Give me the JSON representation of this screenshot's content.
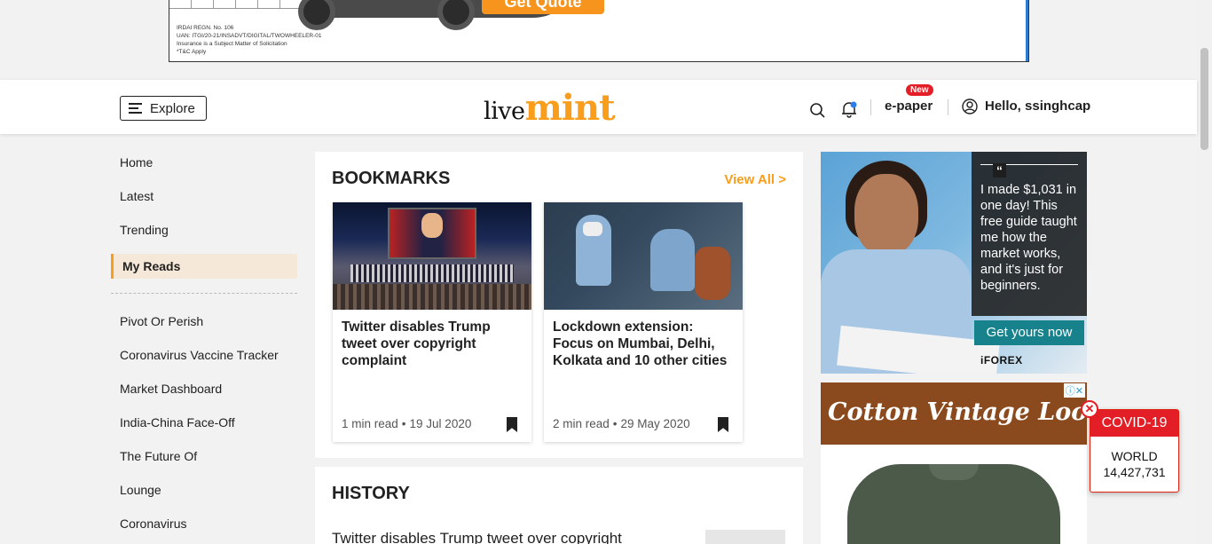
{
  "top_ad": {
    "legal_lines": [
      "IRDAI REGN. No. 106",
      "UAN: ITGI/20-21/INSADVT/DIGITAL/TWOWHEELER-01",
      "Insurance is a Subject Matter of Solicitation",
      "*T&C Apply"
    ],
    "cta_label": "Get Quote"
  },
  "header": {
    "explore_label": "Explore",
    "logo_live": "live",
    "logo_mint": "mint",
    "epaper_label": "e-paper",
    "new_badge": "New",
    "greeting": "Hello, ssinghcap"
  },
  "leftnav": {
    "primary": [
      {
        "label": "Home"
      },
      {
        "label": "Latest"
      },
      {
        "label": "Trending"
      }
    ],
    "active": {
      "label": "My Reads"
    },
    "secondary": [
      {
        "label": "Pivot Or Perish"
      },
      {
        "label": "Coronavirus Vaccine Tracker"
      },
      {
        "label": "Market Dashboard"
      },
      {
        "label": "India-China Face-Off"
      },
      {
        "label": "The Future Of"
      },
      {
        "label": "Lounge"
      },
      {
        "label": "Coronavirus"
      }
    ]
  },
  "bookmarks": {
    "title": "BOOKMARKS",
    "view_all": "View All >",
    "articles": [
      {
        "title": "Twitter disables Trump tweet over copyright complaint",
        "read_time": "1 min read",
        "date": "19 Jul 2020"
      },
      {
        "title": "Lockdown extension: Focus on Mumbai, Delhi, Kolkata and 10 other cities",
        "read_time": "2 min read",
        "date": "29 May 2020"
      }
    ]
  },
  "history": {
    "title": "HISTORY",
    "first_item": "Twitter disables Trump tweet over copyright"
  },
  "right_ads": {
    "ad1": {
      "quote_mark": "“",
      "quote": "I made $1,031 in one day! This free guide taught me how the market works, and it's just for beginners.",
      "cta": "Get yours now",
      "brand": "iFOREX"
    },
    "ad2": {
      "banner": "Cotton Vintage Looks",
      "adchoice": "ⓘ✕"
    }
  },
  "covid_widget": {
    "title": "COVID-19",
    "label": "WORLD",
    "count": "14,427,731",
    "close": "✕"
  },
  "colors": {
    "brand_orange": "#f99d1c",
    "covid_red": "#e41e26",
    "active_bg": "#f6e8d8"
  }
}
